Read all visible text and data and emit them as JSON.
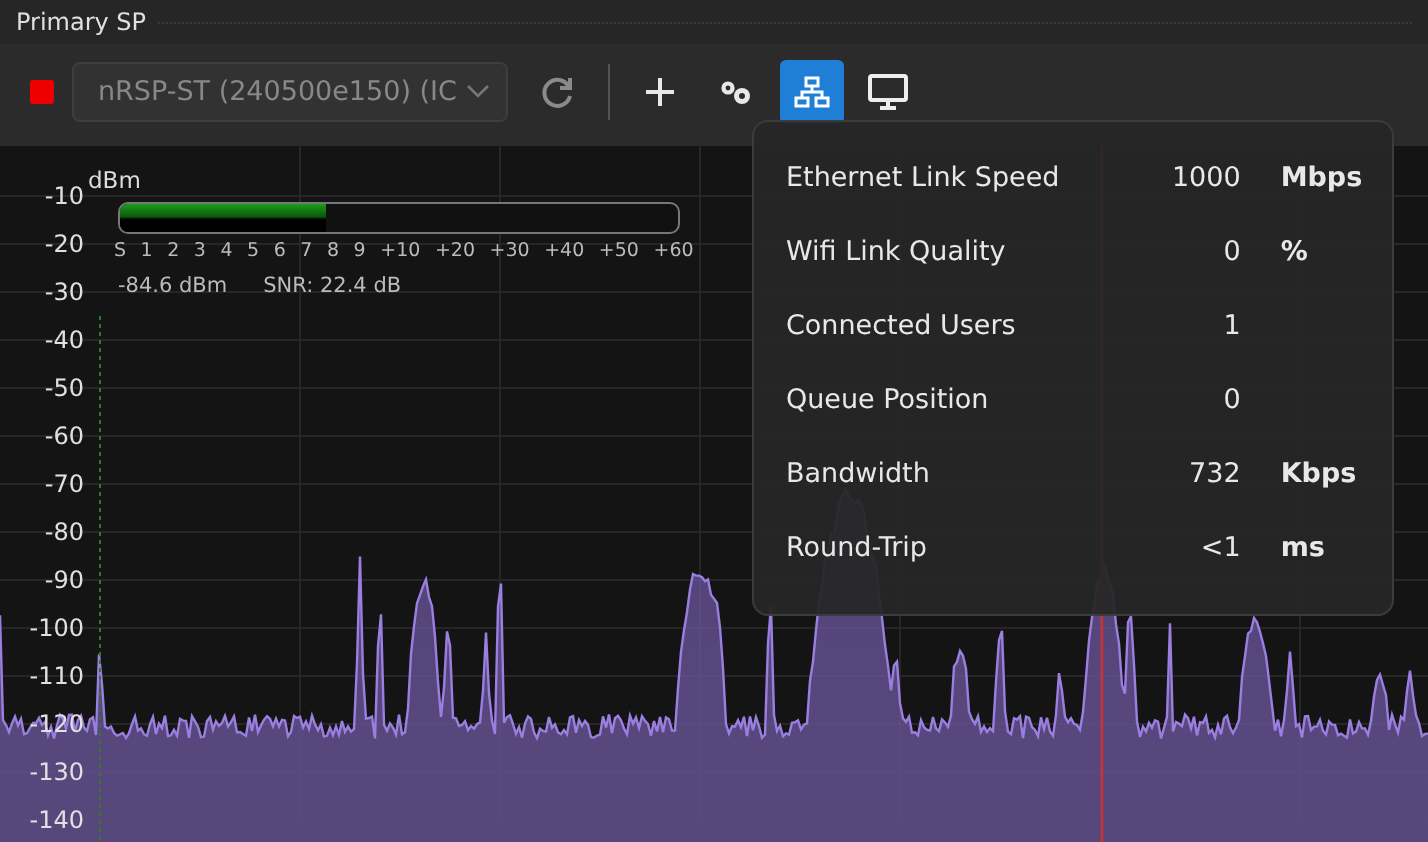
{
  "panel": {
    "title": "Primary SP"
  },
  "toolbar": {
    "device_select": {
      "value": "nRSP-ST (240500e150) (IC",
      "disabled": true
    },
    "buttons": [
      {
        "kind": "stop",
        "selected": false
      },
      {
        "kind": "refresh",
        "selected": false
      },
      {
        "kind": "add",
        "selected": false
      },
      {
        "kind": "settings",
        "selected": false
      },
      {
        "kind": "network",
        "selected": true
      },
      {
        "kind": "display",
        "selected": false
      }
    ]
  },
  "spectrum": {
    "y_unit": "dBm",
    "y_labels": [
      "-10",
      "-20",
      "-30",
      "-40",
      "-50",
      "-60",
      "-70",
      "-80",
      "-90",
      "-100",
      "-110",
      "-120",
      "-130",
      "-140"
    ]
  },
  "s_meter": {
    "level": 0.37,
    "scale": [
      "S",
      "1",
      "2",
      "3",
      "4",
      "5",
      "6",
      "7",
      "8",
      "9",
      "+10",
      "+20",
      "+30",
      "+40",
      "+50",
      "+60"
    ],
    "power": "-84.6 dBm",
    "snr": "SNR:  22.4 dB"
  },
  "network_popover": {
    "rows": [
      {
        "label": "Ethernet Link Speed",
        "value": "1000",
        "unit": "Mbps"
      },
      {
        "label": "Wifi Link Quality",
        "value": "0",
        "unit": "%"
      },
      {
        "label": "Connected Users",
        "value": "1"
      },
      {
        "label": "Queue Position",
        "value": "0"
      },
      {
        "label": "Bandwidth",
        "value": "732",
        "unit": "Kbps"
      },
      {
        "label": "Round-Trip",
        "value": "<1",
        "unit": "ms"
      }
    ]
  }
}
